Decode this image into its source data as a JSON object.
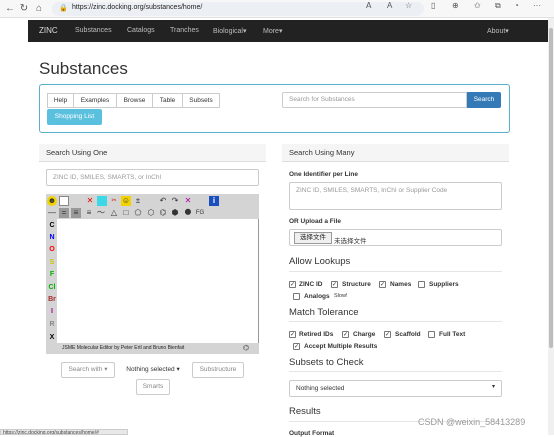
{
  "browser": {
    "url": "https://zinc.docking.org/substances/home/",
    "status_link": "https://zinc.docking.org/substances/home/#"
  },
  "nav": {
    "brand": "ZINC",
    "items": [
      "Substances",
      "Catalogs",
      "Tranches",
      "Biological▾",
      "More▾"
    ],
    "right": "About▾"
  },
  "page": {
    "title": "Substances"
  },
  "top": {
    "tabs": [
      "Help",
      "Examples",
      "Browse",
      "Table",
      "Subsets"
    ],
    "shopping_list": "Shopping List",
    "search_placeholder": "Search for Substances",
    "search_button": "Search"
  },
  "search_one": {
    "heading": "Search Using One",
    "input_placeholder": "ZINC ID, SMILES, SMARTS, or InChI",
    "jsme_credit": "JSME Molecular Editor by Peter Ertl and Bruno Bienfait",
    "elements": [
      "C",
      "N",
      "O",
      "S",
      "F",
      "Cl",
      "Br",
      "I",
      "R",
      "X"
    ],
    "element_colors": [
      "#000000",
      "#0000ff",
      "#ff0000",
      "#c8c800",
      "#00b000",
      "#00b000",
      "#a52a2a",
      "#a000a0",
      "#888888",
      "#000000"
    ],
    "fg_label": "FG",
    "search_with": "Search with ▾",
    "nothing_selected": "Nothing selected ▾",
    "substructure": "Substructure",
    "smarts": "Smarts"
  },
  "search_many": {
    "heading": "Search Using Many",
    "per_line_label": "One Identifier per Line",
    "per_line_placeholder": "ZINC ID, SMILES, SMARTS, InChI or Supplier Code",
    "upload_label": "OR Upload a File",
    "choose_file": "选择文件",
    "no_file": "未选择文件",
    "allow_lookups": "Allow Lookups",
    "lookups": [
      {
        "label": "ZINC ID",
        "checked": true
      },
      {
        "label": "Structure",
        "checked": true
      },
      {
        "label": "Names",
        "checked": true
      },
      {
        "label": "Suppliers",
        "checked": false
      },
      {
        "label": "Analogs",
        "checked": false
      }
    ],
    "analogs_note": "Slow!",
    "match_tolerance": "Match Tolerance",
    "tolerance": [
      {
        "label": "Retired IDs",
        "checked": true
      },
      {
        "label": "Charge",
        "checked": true
      },
      {
        "label": "Scaffold",
        "checked": true
      },
      {
        "label": "Full Text",
        "checked": false
      },
      {
        "label": "Accept Multiple Results",
        "checked": true
      }
    ],
    "subsets_to_check": "Subsets to Check",
    "subsets_selected": "Nothing selected",
    "results": "Results",
    "output_format": "Output Format"
  },
  "watermark": "CSDN @weixin_58413289"
}
